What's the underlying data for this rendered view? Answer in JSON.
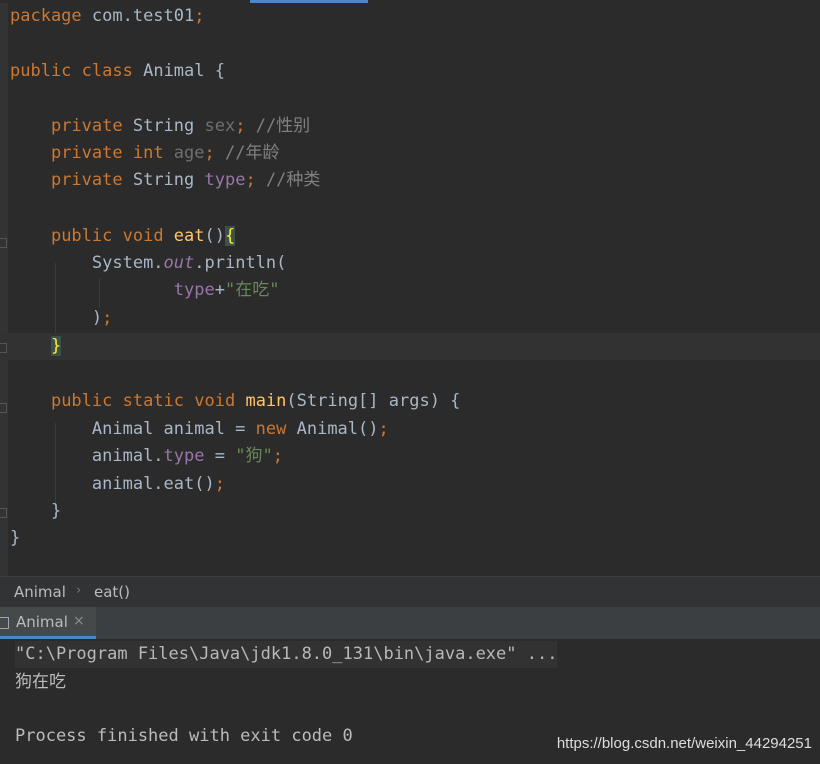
{
  "editor": {
    "lines": {
      "l1": {
        "kw": "package",
        "rest": " com.test01",
        "semi": ";"
      },
      "l3": {
        "kw1": "public",
        "kw2": "class",
        "name": " Animal {"
      },
      "l5": {
        "kw": "private",
        "type": " String ",
        "field": "sex",
        "semi": ";",
        "comment": " //性别"
      },
      "l6": {
        "kw1": "private",
        "kw2": " int",
        "field": " age",
        "semi": ";",
        "comment": " //年龄"
      },
      "l7": {
        "kw": "private",
        "type": " String ",
        "field": "type",
        "semi": ";",
        "comment": " //种类"
      },
      "l9": {
        "kw1": "public",
        "kw2": " void",
        "fn": " eat",
        "paren": "()",
        "brace": "{"
      },
      "l10": {
        "obj": "System.",
        "static": "out",
        "rest": ".println("
      },
      "l11": {
        "field": "type",
        "op": "+",
        "str": "\"在吃\""
      },
      "l12": {
        "rest": ")",
        "semi": ";"
      },
      "l13": {
        "brace": "}"
      },
      "l15": {
        "kw1": "public",
        "kw2": " static",
        "kw3": " void",
        "fn": " main",
        "rest": "(String[] args) {"
      },
      "l16": {
        "rest": "Animal animal = ",
        "kw": "new",
        "rest2": " Animal()",
        "semi": ";"
      },
      "l17": {
        "rest": "animal.",
        "field": "type",
        "op": " = ",
        "str": "\"狗\"",
        "semi": ";"
      },
      "l18": {
        "rest": "animal.eat()",
        "semi": ";"
      },
      "l19": {
        "rest": "}"
      },
      "l20": {
        "rest": "}"
      }
    }
  },
  "breadcrumb": {
    "item1": "Animal",
    "sep": "›",
    "item2": "eat()"
  },
  "run_panel": {
    "tab_label": "Animal",
    "close": "×"
  },
  "console": {
    "cmd": "\"C:\\Program Files\\Java\\jdk1.8.0_131\\bin\\java.exe\" ...",
    "output": "狗在吃",
    "exit": "Process finished with exit code 0"
  },
  "watermark": "https://blog.csdn.net/weixin_44294251",
  "colors": {
    "keyword": "#cc7832",
    "field": "#9876aa",
    "string": "#6a8759",
    "function": "#ffc66d",
    "comment": "#808080"
  }
}
